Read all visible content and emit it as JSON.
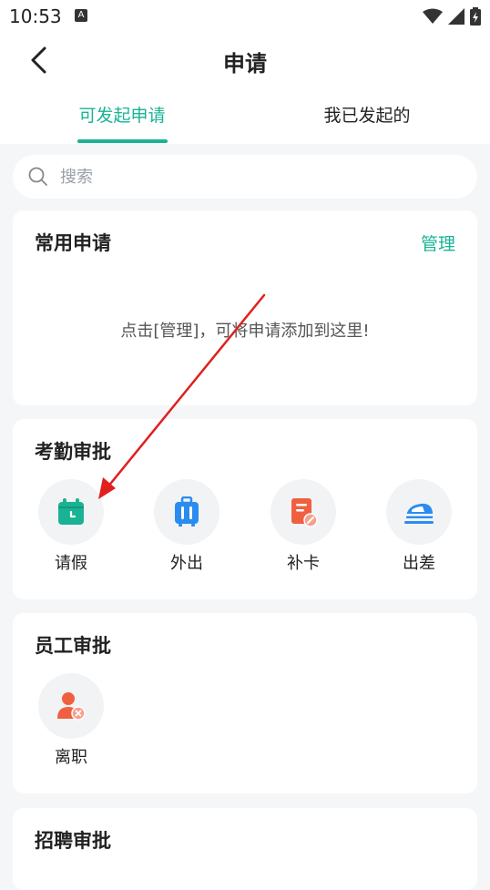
{
  "status_bar": {
    "time": "10:53",
    "notification_icon_letter": "A"
  },
  "header": {
    "title": "申请"
  },
  "tabs": [
    {
      "label": "可发起申请",
      "active": true
    },
    {
      "label": "我已发起的",
      "active": false
    }
  ],
  "search": {
    "placeholder": "搜索"
  },
  "sections": {
    "common": {
      "title": "常用申请",
      "manage_label": "管理",
      "empty_hint": "点击[管理]，可将申请添加到这里!"
    },
    "attendance": {
      "title": "考勤审批",
      "items": [
        {
          "label": "请假",
          "icon": "calendar-clock-icon"
        },
        {
          "label": "外出",
          "icon": "suitcase-icon"
        },
        {
          "label": "补卡",
          "icon": "document-edit-icon"
        },
        {
          "label": "出差",
          "icon": "train-icon"
        }
      ]
    },
    "employee": {
      "title": "员工审批",
      "items": [
        {
          "label": "离职",
          "icon": "person-remove-icon"
        }
      ]
    },
    "recruit": {
      "title": "招聘审批"
    }
  },
  "colors": {
    "accent": "#19b394",
    "background": "#f5f6f8",
    "annotation_arrow": "#e02020"
  }
}
